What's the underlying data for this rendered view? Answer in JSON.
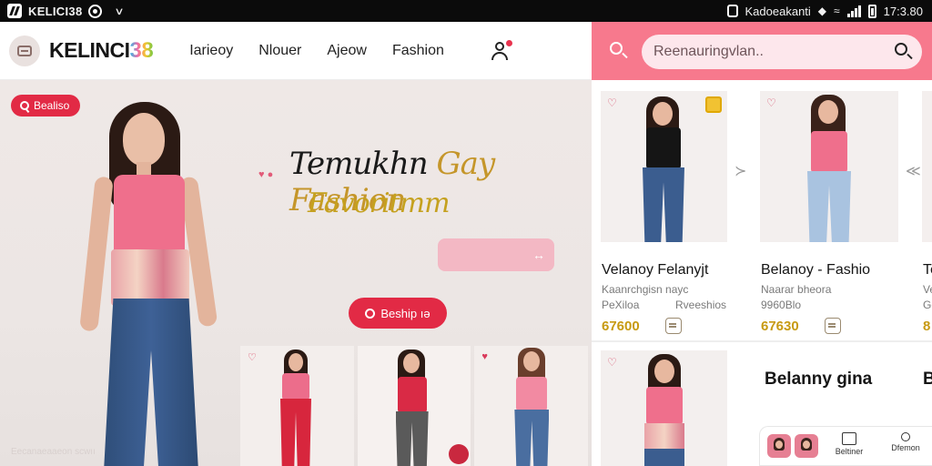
{
  "status_bar": {
    "app_name": "KELICI38",
    "carrier": "Kadoeakanti",
    "time": "17:3.80"
  },
  "header": {
    "brand_a": "KELINCI",
    "brand_b": "38",
    "nav": [
      "Iarieoy",
      "Nlouer",
      "Ajeow",
      "Fashion"
    ]
  },
  "hero": {
    "badge": "Bealiso",
    "headline_a": "Temukhn ",
    "headline_b": "Gay Fashion",
    "headline2": "Favoritmm",
    "cta": "Beship ıə",
    "watermark": "Eecanaeaaeon scwıı"
  },
  "search": {
    "placeholder": "Reenauringvlan.."
  },
  "products": [
    {
      "title": "Velanoy  Felanyjt",
      "line1": "Kaanrchgisn nayc",
      "line2a": "PeXiloa",
      "line2b": "Rveeshios",
      "price": "67600"
    },
    {
      "title": "Belanoy - Fashio",
      "line1": "Naarar bheora",
      "line2a": "9960Blo",
      "line2b": "",
      "price": "67630"
    },
    {
      "title": "Te",
      "line1": "Ve",
      "line2a": "Ge",
      "line2b": "",
      "price": "8"
    }
  ],
  "row2": {
    "title": "Belanny gina",
    "title2": "B"
  },
  "bottom_nav": {
    "item1": "Beltiner",
    "item2": "Dfemon"
  },
  "colors": {
    "accent_red": "#e22a45",
    "header_pink": "#f7798d",
    "price_gold": "#c79a12"
  }
}
